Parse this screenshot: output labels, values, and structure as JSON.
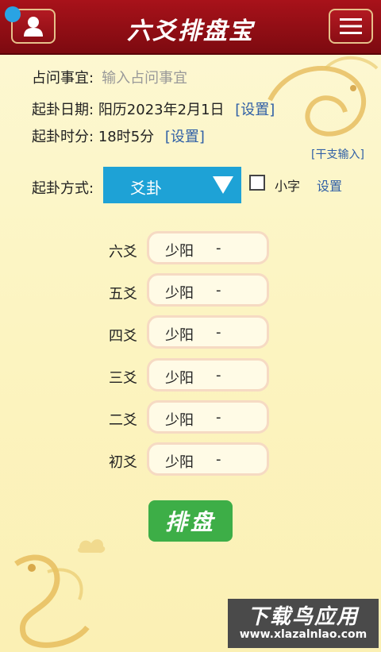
{
  "header": {
    "title": "六爻排盘宝",
    "user_icon": "user-icon",
    "menu_icon": "hamburger-menu-icon"
  },
  "form": {
    "question_label": "占问事宜:",
    "question_placeholder": "输入占问事宜",
    "date_label": "起卦日期:",
    "date_value": "阳历2023年2月1日",
    "date_set": "[设置]",
    "time_label": "起卦时分:",
    "time_value": "18时5分",
    "time_set": "[设置]",
    "ganzhi_input": "[干支输入]",
    "method_label": "起卦方式:",
    "method_value": "爻卦",
    "small_text_label": "小字",
    "settings_link": "设置"
  },
  "yao_lines": [
    {
      "label": "六爻",
      "value": "少阳",
      "symbol": "-"
    },
    {
      "label": "五爻",
      "value": "少阳",
      "symbol": "-"
    },
    {
      "label": "四爻",
      "value": "少阳",
      "symbol": "-"
    },
    {
      "label": "三爻",
      "value": "少阳",
      "symbol": "-"
    },
    {
      "label": "二爻",
      "value": "少阳",
      "symbol": "-"
    },
    {
      "label": "初爻",
      "value": "少阳",
      "symbol": "-"
    }
  ],
  "submit_label": "排盘",
  "watermark": {
    "title": "下载鸟应用",
    "url": "www.xlazalnlao.com"
  },
  "colors": {
    "header_red": "#8f0f16",
    "select_blue": "#1ea2d6",
    "submit_green": "#3dae47",
    "link_blue": "#2f5fa6"
  }
}
